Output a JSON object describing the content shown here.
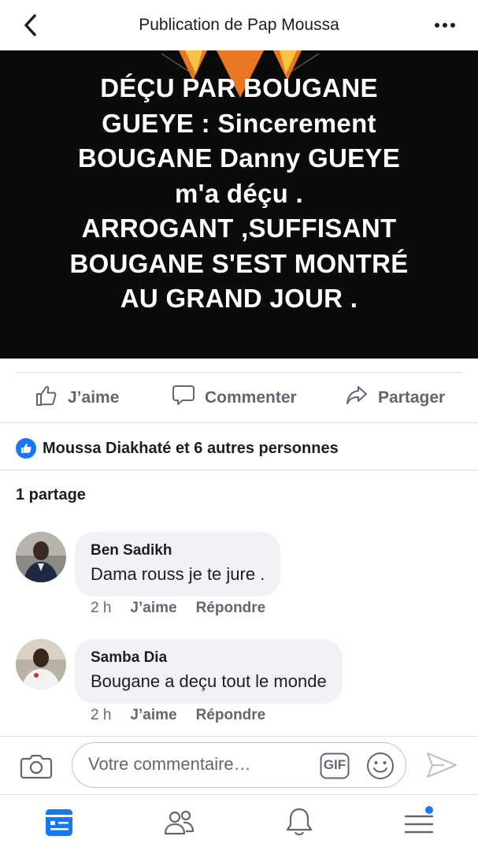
{
  "header": {
    "title": "Publication de Pap Moussa",
    "back_icon": "chevron-left-icon",
    "more_icon": "more-dots-icon"
  },
  "post": {
    "text_lines": [
      "DÉÇU PAR BOUGANE",
      "GUEYE : Sincerement",
      "BOUGANE Danny GUEYE",
      "m'a déçu .",
      "ARROGANT ,SUFFISANT",
      "BOUGANE S'EST MONTRÉ",
      "AU GRAND JOUR ."
    ],
    "background_color": "#0b0b0b",
    "text_color": "#ffffff"
  },
  "actions": {
    "like": "J’aime",
    "comment": "Commenter",
    "share": "Partager"
  },
  "reactions": {
    "summary": "Moussa Diakhaté et 6 autres personnes",
    "icon": "like-badge-icon",
    "color": "#1877f2"
  },
  "shares": {
    "label": "1 partage"
  },
  "comments": [
    {
      "author": "Ben Sadikh",
      "text": "Dama rouss je te jure .",
      "time": "2 h",
      "like": "J’aime",
      "reply": "Répondre"
    },
    {
      "author": "Samba Dia",
      "text": "Bougane a deçu tout le monde",
      "time": "2 h",
      "like": "J’aime",
      "reply": "Répondre"
    }
  ],
  "composer": {
    "placeholder": "Votre commentaire…",
    "gif_label": "GIF"
  },
  "tabbar": {
    "items": [
      "news-feed-icon",
      "friends-icon",
      "notifications-icon",
      "menu-icon"
    ],
    "active_color": "#1877f2",
    "badge_color": "#1877f2"
  }
}
